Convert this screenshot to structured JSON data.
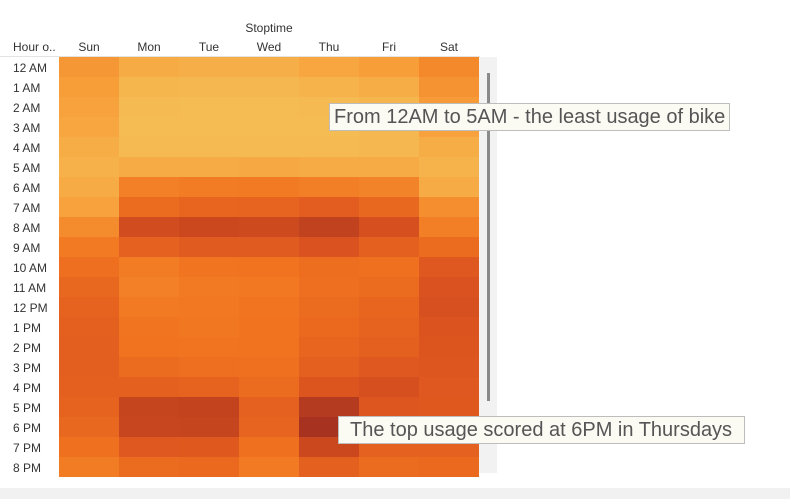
{
  "chart_data": {
    "type": "heatmap",
    "title": "Stoptime",
    "row_header": "Hour o..",
    "columns": [
      "Sun",
      "Mon",
      "Tue",
      "Wed",
      "Thu",
      "Fri",
      "Sat"
    ],
    "rows": [
      "12 AM",
      "1 AM",
      "2 AM",
      "3 AM",
      "4 AM",
      "5 AM",
      "6 AM",
      "7 AM",
      "8 AM",
      "9 AM",
      "10 AM",
      "11 AM",
      "12 PM",
      "1 PM",
      "2 PM",
      "3 PM",
      "4 PM",
      "5 PM",
      "6 PM",
      "7 PM",
      "8 PM"
    ],
    "values": [
      [
        0.3,
        0.2,
        0.18,
        0.18,
        0.22,
        0.26,
        0.38
      ],
      [
        0.26,
        0.15,
        0.14,
        0.14,
        0.16,
        0.19,
        0.32
      ],
      [
        0.24,
        0.13,
        0.12,
        0.12,
        0.13,
        0.15,
        0.28
      ],
      [
        0.22,
        0.12,
        0.12,
        0.12,
        0.12,
        0.14,
        0.24
      ],
      [
        0.19,
        0.13,
        0.13,
        0.13,
        0.13,
        0.14,
        0.19
      ],
      [
        0.17,
        0.2,
        0.2,
        0.21,
        0.2,
        0.2,
        0.16
      ],
      [
        0.2,
        0.43,
        0.45,
        0.46,
        0.44,
        0.41,
        0.2
      ],
      [
        0.24,
        0.56,
        0.6,
        0.61,
        0.66,
        0.58,
        0.35
      ],
      [
        0.36,
        0.79,
        0.82,
        0.81,
        0.87,
        0.77,
        0.44
      ],
      [
        0.46,
        0.63,
        0.68,
        0.68,
        0.74,
        0.64,
        0.56
      ],
      [
        0.53,
        0.45,
        0.49,
        0.5,
        0.54,
        0.52,
        0.7
      ],
      [
        0.58,
        0.43,
        0.46,
        0.47,
        0.53,
        0.55,
        0.74
      ],
      [
        0.62,
        0.46,
        0.47,
        0.49,
        0.56,
        0.6,
        0.76
      ],
      [
        0.64,
        0.49,
        0.48,
        0.5,
        0.57,
        0.62,
        0.73
      ],
      [
        0.65,
        0.5,
        0.49,
        0.5,
        0.6,
        0.64,
        0.72
      ],
      [
        0.65,
        0.56,
        0.53,
        0.52,
        0.64,
        0.7,
        0.71
      ],
      [
        0.64,
        0.64,
        0.62,
        0.56,
        0.72,
        0.77,
        0.7
      ],
      [
        0.62,
        0.85,
        0.86,
        0.63,
        0.93,
        0.71,
        0.69
      ],
      [
        0.58,
        0.84,
        0.85,
        0.61,
        1.0,
        0.7,
        0.67
      ],
      [
        0.52,
        0.7,
        0.69,
        0.52,
        0.82,
        0.63,
        0.63
      ],
      [
        0.45,
        0.56,
        0.57,
        0.46,
        0.64,
        0.55,
        0.57
      ]
    ],
    "color_scale": [
      "#f3d66c",
      "#f7a03a",
      "#f1731f",
      "#d9511f",
      "#a6321f"
    ],
    "annotations": [
      "From 12AM to 5AM - the least usage of bike",
      "The top usage scored at 6PM in Thursdays"
    ]
  }
}
